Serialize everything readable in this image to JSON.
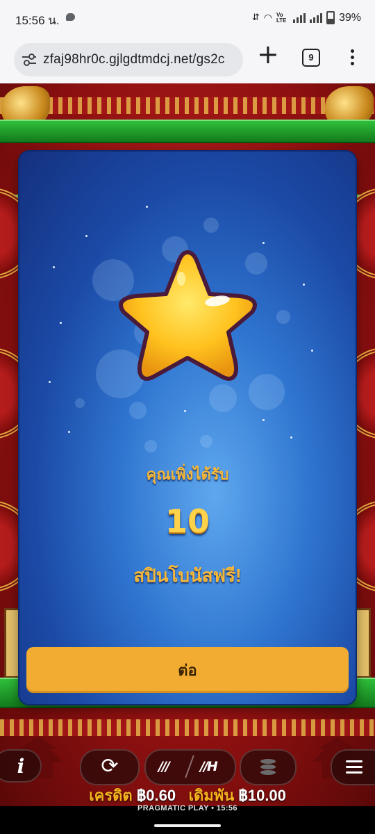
{
  "status_bar": {
    "time": "15:56 น.",
    "battery": "39%",
    "network_label": "Vo LTE"
  },
  "browser": {
    "url": "zfaj98hr0c.gjlgdtmdcj.net/gs2c",
    "tab_count": "9",
    "icons": {
      "site_settings": "tune-icon",
      "new_tab": "plus-icon",
      "tabs": "tabs-count-icon",
      "menu": "kebab-menu-icon"
    }
  },
  "modal": {
    "message_line1": "คุณเพิ่งได้รับ",
    "spins_count": "10",
    "message_line2": "สปินโบนัสฟรี!",
    "continue_label": "ต่อ",
    "icon": "star-icon",
    "colors": {
      "accent": "#f2ac32",
      "text_gold": "#f5b73a",
      "panel_blue": "#2f75d0"
    }
  },
  "controls": {
    "info_label": "i",
    "autoplay_icon": "autoplay-icon",
    "speed_normal": "///",
    "speed_turbo": "//H",
    "coins_icon": "coin-stack-icon",
    "menu_icon": "hamburger-menu-icon"
  },
  "footer": {
    "credit_label": "เครดิต",
    "credit_value": "฿0.60",
    "bet_label": "เดิมพัน",
    "bet_value": "฿10.00",
    "brand": "PRAGMATIC PLAY",
    "time": "15:56"
  }
}
